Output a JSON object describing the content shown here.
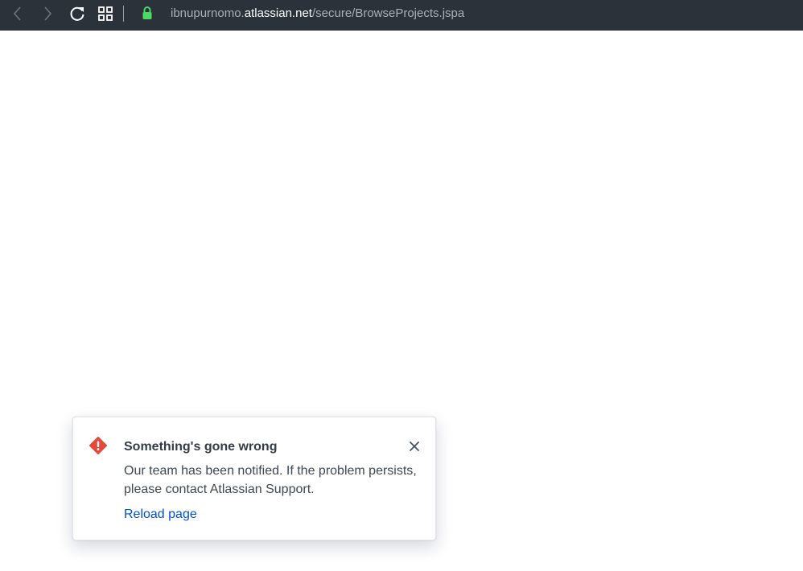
{
  "browser": {
    "url_prefix": "ibnupurnomo.",
    "url_domain": "atlassian.net",
    "url_path": "/secure/BrowseProjects.jspa",
    "icons": {
      "back": "chevron-left-icon",
      "forward": "chevron-right-icon",
      "reload": "reload-icon",
      "apps": "grid-icon",
      "secure": "lock-icon"
    },
    "lock_color": "#4cd964"
  },
  "error_flag": {
    "title": "Something's gone wrong",
    "message": "Our team has been notified. If the problem persists, please contact Atlassian Support.",
    "action_label": "Reload page",
    "icon": "error-icon",
    "close_icon": "close-icon",
    "colors": {
      "error": "#e5493a",
      "link": "#0052cc"
    }
  }
}
